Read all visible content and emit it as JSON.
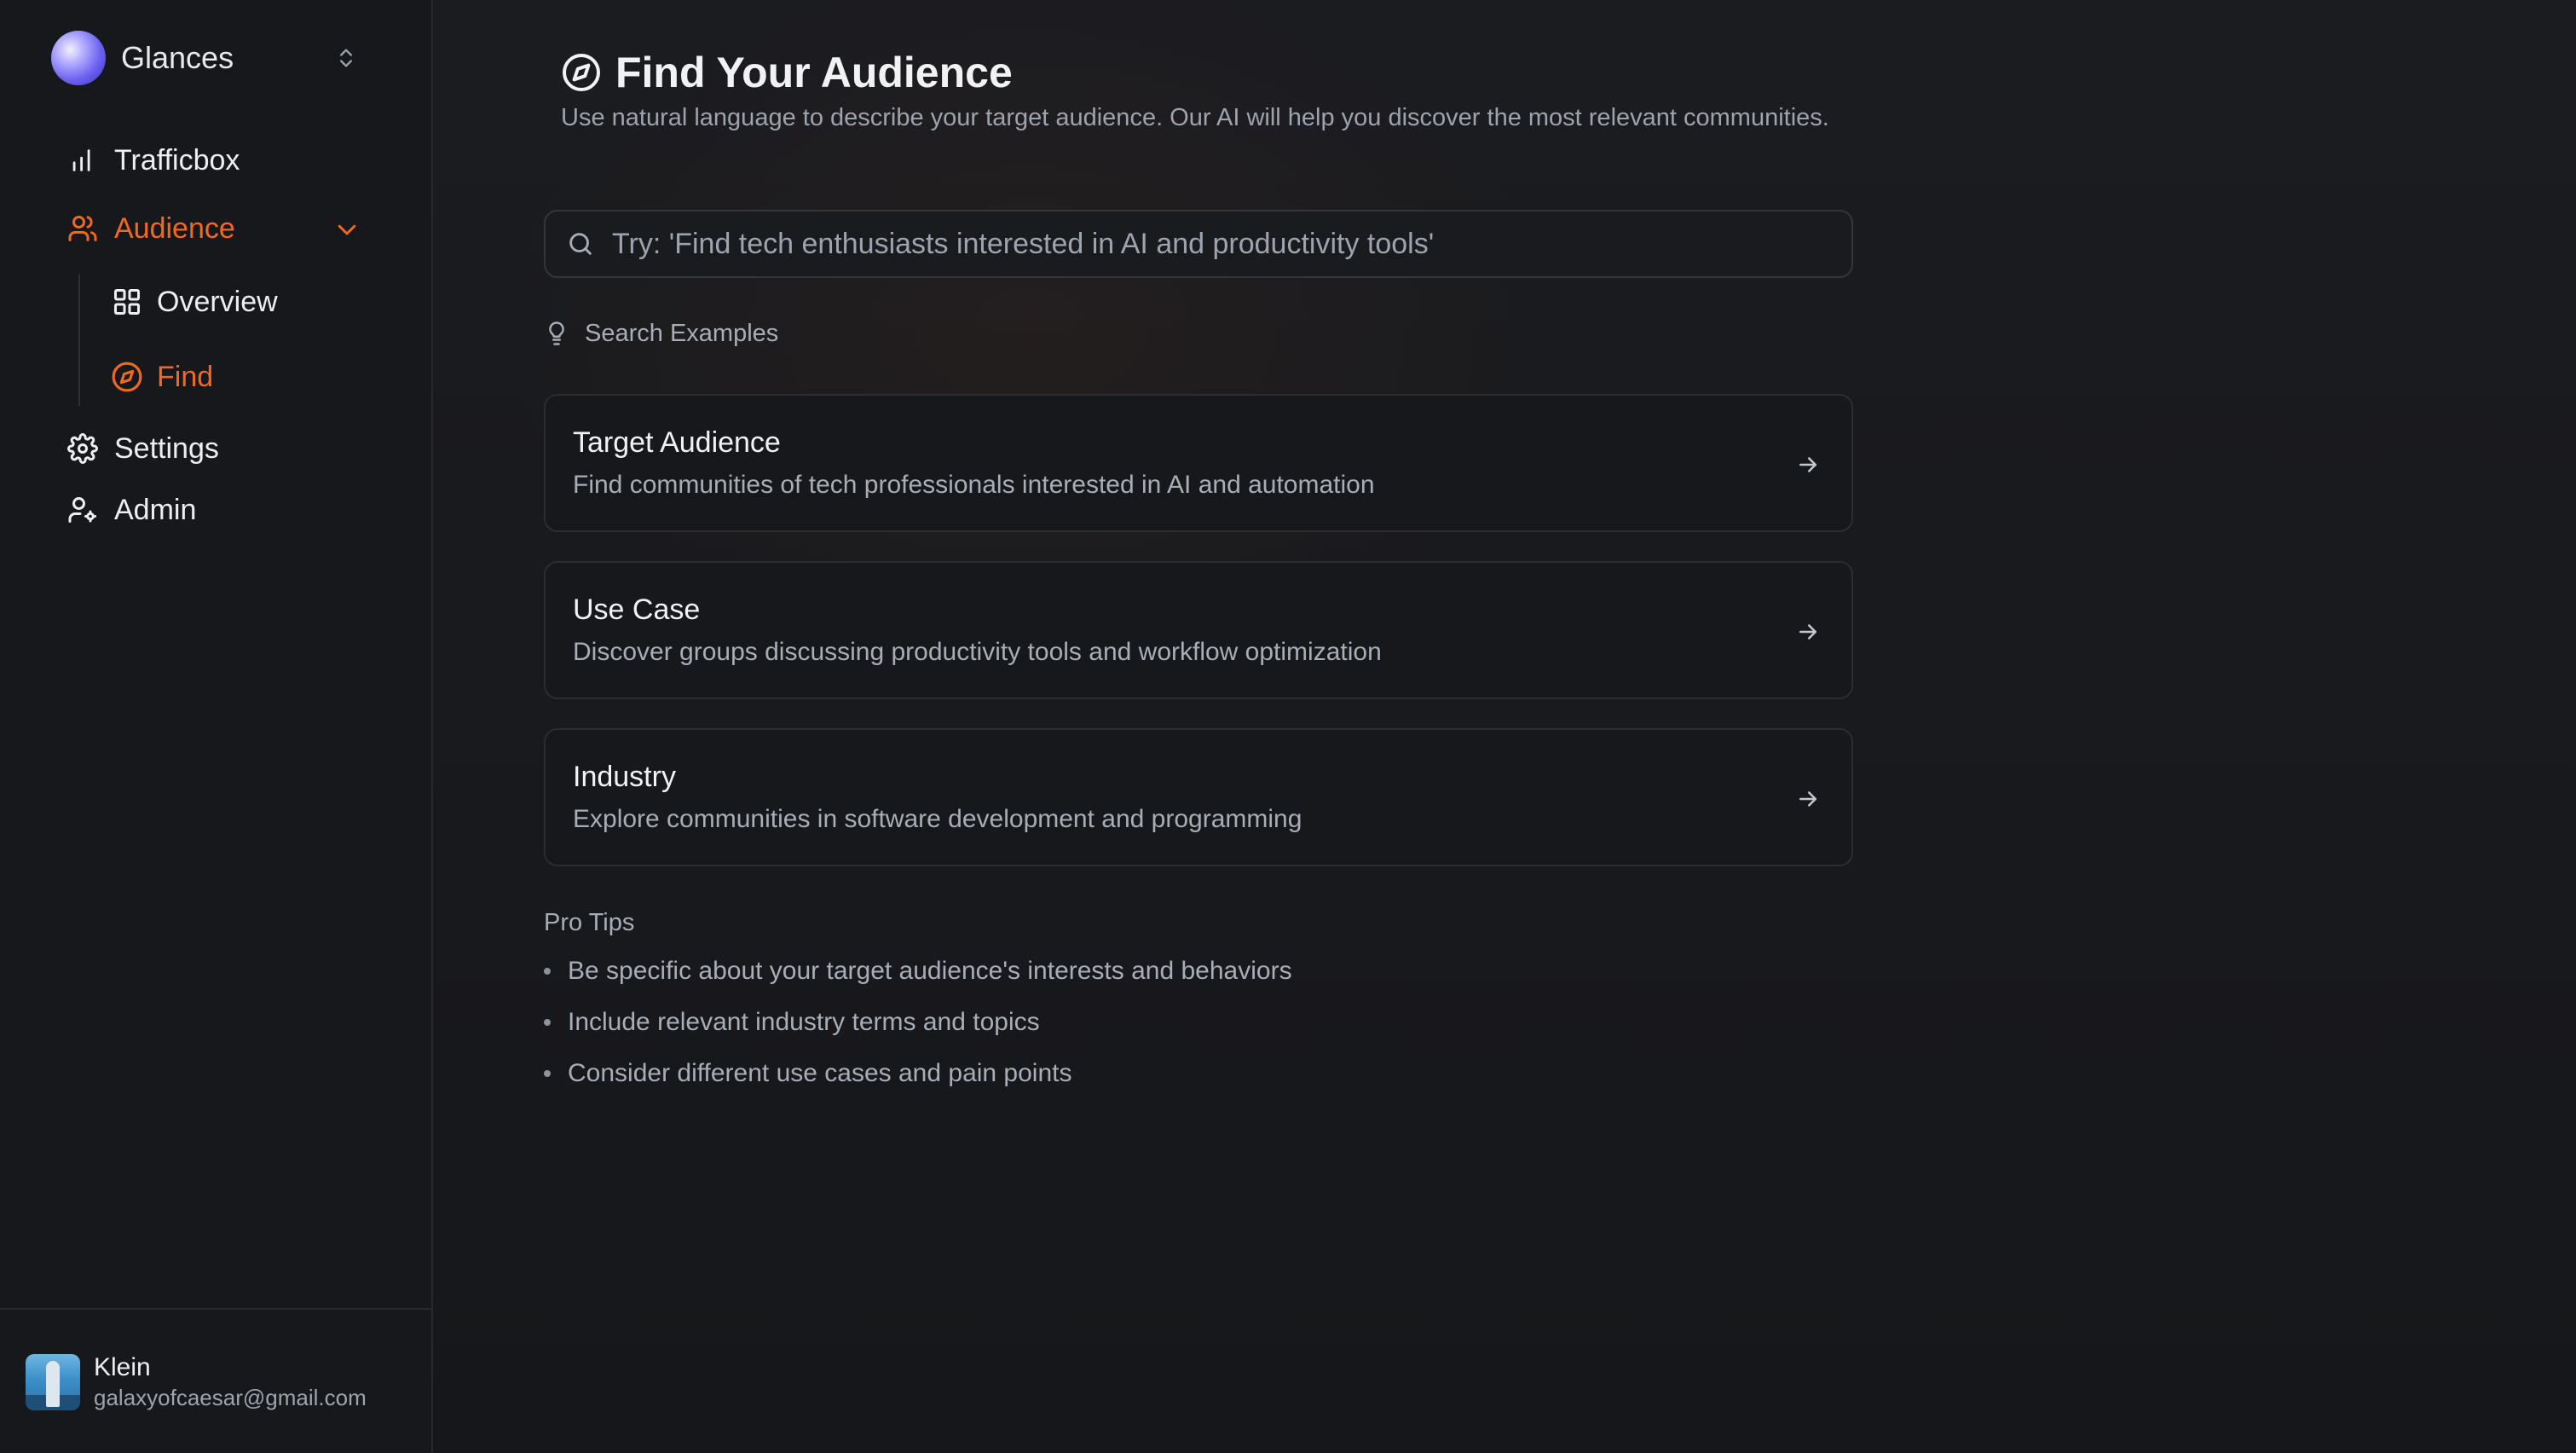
{
  "workspace": {
    "name": "Glances",
    "logo_icon": "gradient-orb",
    "switch_icon": "chevron-up-down-icon"
  },
  "nav": {
    "trafficbox": {
      "label": "Trafficbox",
      "icon": "bar-chart-icon"
    },
    "audience": {
      "label": "Audience",
      "icon": "users-icon",
      "expand_icon": "chevron-down-icon"
    },
    "overview": {
      "label": "Overview",
      "icon": "grid-icon"
    },
    "find": {
      "label": "Find",
      "icon": "compass-icon"
    },
    "settings": {
      "label": "Settings",
      "icon": "gear-icon"
    },
    "admin": {
      "label": "Admin",
      "icon": "user-cog-icon"
    }
  },
  "user": {
    "name": "Klein",
    "email": "galaxyofcaesar@gmail.com"
  },
  "page": {
    "title": "Find Your Audience",
    "subtitle": "Use natural language to describe your target audience. Our AI will help you discover the most relevant communities."
  },
  "search": {
    "placeholder": "Try: 'Find tech enthusiasts interested in AI and productivity tools'",
    "value": ""
  },
  "examples": {
    "label": "Search Examples",
    "items": [
      {
        "title": "Target Audience",
        "description": "Find communities of tech professionals interested in AI and automation"
      },
      {
        "title": "Use Case",
        "description": "Discover groups discussing productivity tools and workflow optimization"
      },
      {
        "title": "Industry",
        "description": "Explore communities in software development and programming"
      }
    ]
  },
  "tips": {
    "title": "Pro Tips",
    "items": [
      "Be specific about your target audience's interests and behaviors",
      "Include relevant industry terms and topics",
      "Consider different use cases and pain points"
    ]
  },
  "colors": {
    "accent": "#f0691f",
    "background": "#16171a",
    "sidebar": "#17181b"
  }
}
